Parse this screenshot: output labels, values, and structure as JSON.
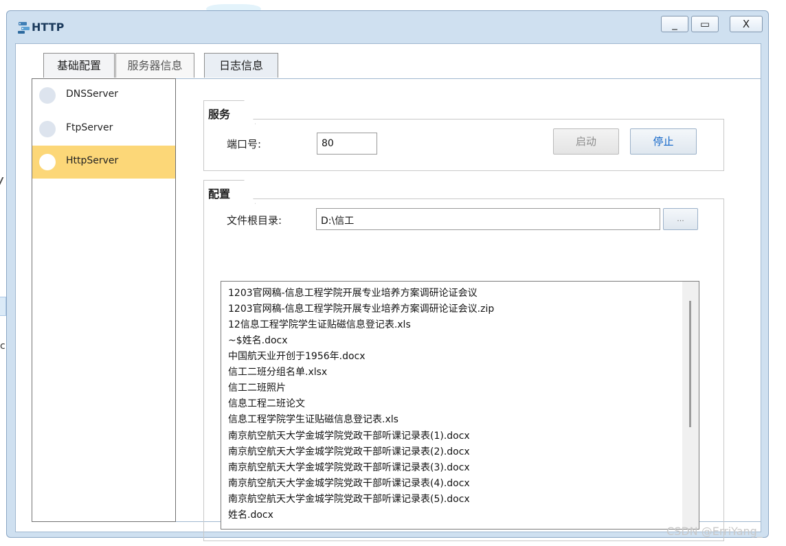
{
  "window": {
    "title": "HTTP",
    "minimize_label": "_",
    "maximize_label": "▭",
    "close_label": "X"
  },
  "tabs": [
    {
      "label": "基础配置"
    },
    {
      "label": "服务器信息"
    },
    {
      "label": "日志信息"
    }
  ],
  "sidebar": {
    "items": [
      {
        "label": "DNSServer"
      },
      {
        "label": "FtpServer"
      },
      {
        "label": "HttpServer",
        "selected": true
      }
    ]
  },
  "service": {
    "group_title": "服务",
    "port_label": "端口号:",
    "port_value": "80",
    "start_label": "启动",
    "stop_label": "停止"
  },
  "config": {
    "group_title": "配置",
    "root_label": "文件根目录:",
    "root_value": "D:\\信工",
    "browse_label": "..."
  },
  "files": [
    "1203官网稿-信息工程学院开展专业培养方案调研论证会议",
    "1203官网稿-信息工程学院开展专业培养方案调研论证会议.zip",
    "12信息工程学院学生证贴磁信息登记表.xls",
    "~$姓名.docx",
    "中国航天业开创于1956年.docx",
    "信工二班分组名单.xlsx",
    "信工二班照片",
    "信息工程二班论文",
    "信息工程学院学生证贴磁信息登记表.xls",
    "南京航空航天大学金城学院党政干部听课记录表(1).docx",
    "南京航空航天大学金城学院党政干部听课记录表(2).docx",
    "南京航空航天大学金城学院党政干部听课记录表(3).docx",
    "南京航空航天大学金城学院党政干部听课记录表(4).docx",
    "南京航空航天大学金城学院党政干部听课记录表(5).docx",
    "姓名.docx"
  ],
  "watermark": "CSDN @ErriYang_",
  "colors": {
    "frame": "#cfe0f0",
    "selected_item": "#fcd778",
    "stop_button_text": "#0f64c8"
  }
}
